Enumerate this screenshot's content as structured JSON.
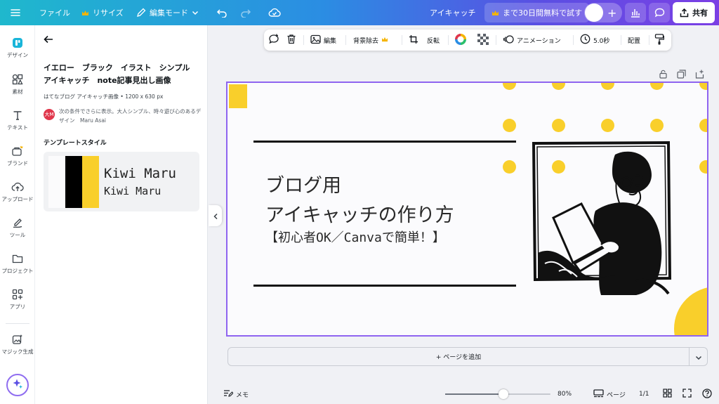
{
  "topbar": {
    "file_label": "ファイル",
    "resize_label": "リサイズ",
    "edit_mode_label": "編集モード",
    "doc_title": "アイキャッチ",
    "trial_label": "まで30日間無料で試す",
    "share_label": "共有"
  },
  "rail": {
    "items": [
      {
        "label": "デザイン"
      },
      {
        "label": "素材"
      },
      {
        "label": "テキスト"
      },
      {
        "label": "ブランド"
      },
      {
        "label": "アップロード"
      },
      {
        "label": "ツール"
      },
      {
        "label": "プロジェクト"
      },
      {
        "label": "アプリ"
      },
      {
        "label": "マジック生成"
      }
    ]
  },
  "panel": {
    "title": "イエロー　ブラック　イラスト　シンプル　アイキャッチ　note記事見出し画像",
    "meta": "はてなブログ アイキャッチ画像 • 1200 x 630 px",
    "author_initials": "大M",
    "description": "次の条件でさらに表示。大人シンプル、時々遊び心のあるデザイン　Maru Asai",
    "section_label": "テンプレートスタイル",
    "style_font_heading": "Kiwi Maru",
    "style_font_body": "Kiwi Maru",
    "palette": [
      "#fbfbfc",
      "#000000",
      "#f9cf2b"
    ]
  },
  "context_toolbar": {
    "edit_label": "編集",
    "bg_remove_label": "背景除去",
    "flip_label": "反転",
    "animation_label": "アニメーション",
    "duration_label": "5.0秒",
    "position_label": "配置"
  },
  "canvas": {
    "headline_1": "ブログ用",
    "headline_2": "アイキャッチの作り方",
    "headline_3": "【初心者OK／Canvaで簡単！】",
    "accent_color": "#f9cf2b"
  },
  "add_page_label": "+ ページを追加",
  "bottombar": {
    "notes_label": "メモ",
    "zoom_value": "80%",
    "zoom_fraction": 0.55,
    "pages_label": "ページ",
    "page_count": "1/1"
  },
  "colors": {
    "selection": "#8f64f0",
    "topbar_start": "#1fb8cd",
    "topbar_end": "#7b3fe4",
    "crown": "#f5b400"
  }
}
